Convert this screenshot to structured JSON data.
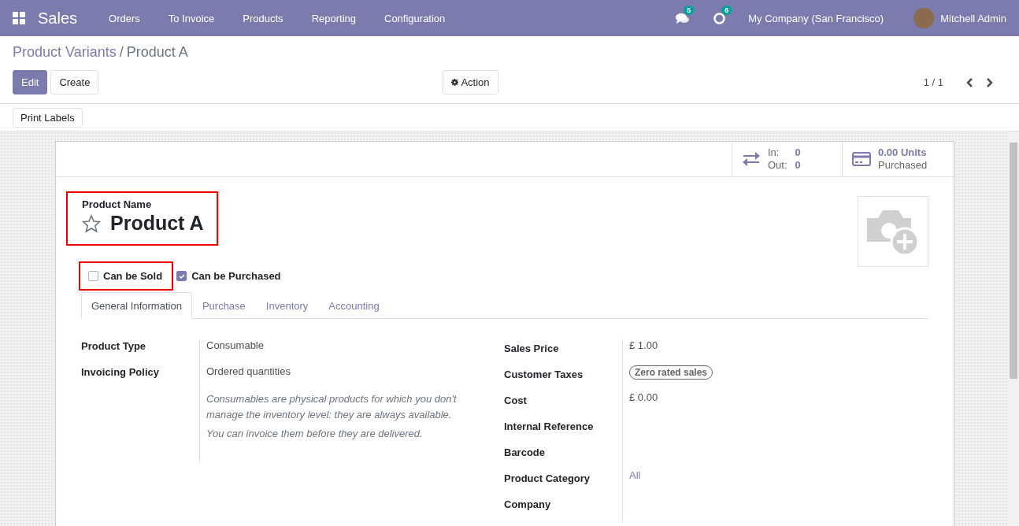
{
  "navbar": {
    "app": "Sales",
    "menu": [
      "Orders",
      "To Invoice",
      "Products",
      "Reporting",
      "Configuration"
    ],
    "messages_count": "5",
    "activities_count": "6",
    "company": "My Company (San Francisco)",
    "user": "Mitchell Admin"
  },
  "breadcrumb_separator": "/",
  "breadcrumb": [
    {
      "label": "Product Variants",
      "kind": "link"
    },
    {
      "label": "Product A",
      "kind": "current"
    }
  ],
  "buttons": [
    {
      "label": "Edit",
      "kind": "primary"
    },
    {
      "label": "Create",
      "kind": "secondary"
    }
  ],
  "action_button": "Action",
  "pager": "1 / 1",
  "print_labels": "Print Labels",
  "stat_buttons": [
    {
      "kind": "in_out",
      "in_label": "In:",
      "in_value": "0",
      "out_label": "Out:",
      "out_value": "0"
    },
    {
      "kind": "purchased",
      "value": "0.00 Units",
      "label": "Purchased"
    }
  ],
  "product": {
    "label": "Product Name",
    "name": "Product A",
    "favorite": false,
    "highlighted": true
  },
  "options": [
    {
      "label": "Can be Sold",
      "checked": false,
      "highlighted": true
    },
    {
      "label": "Can be Purchased",
      "checked": true,
      "highlighted": false
    }
  ],
  "tabs": [
    {
      "label": "General Information",
      "selected": true
    },
    {
      "label": "Purchase",
      "selected": false
    },
    {
      "label": "Inventory",
      "selected": false
    },
    {
      "label": "Accounting",
      "selected": false
    }
  ],
  "left_fields": [
    {
      "label": "Product Type",
      "value": "Consumable"
    },
    {
      "label": "Invoicing Policy",
      "value": "Ordered quantities"
    }
  ],
  "help_texts": [
    "Consumables are physical products for which you don't manage the inventory level: they are always available.",
    "You can invoice them before they are delivered."
  ],
  "right_fields": [
    {
      "label": "Sales Price",
      "value": "£ 1.00",
      "kind": "text"
    },
    {
      "label": "Customer Taxes",
      "value": "Zero rated sales",
      "kind": "tag"
    },
    {
      "label": "Cost",
      "value": "£ 0.00",
      "kind": "text"
    },
    {
      "label": "Internal Reference",
      "kind": "text"
    },
    {
      "label": "Barcode",
      "kind": "text"
    },
    {
      "label": "Product Category",
      "value": "All",
      "kind": "link"
    },
    {
      "label": "Company",
      "kind": "text"
    }
  ]
}
